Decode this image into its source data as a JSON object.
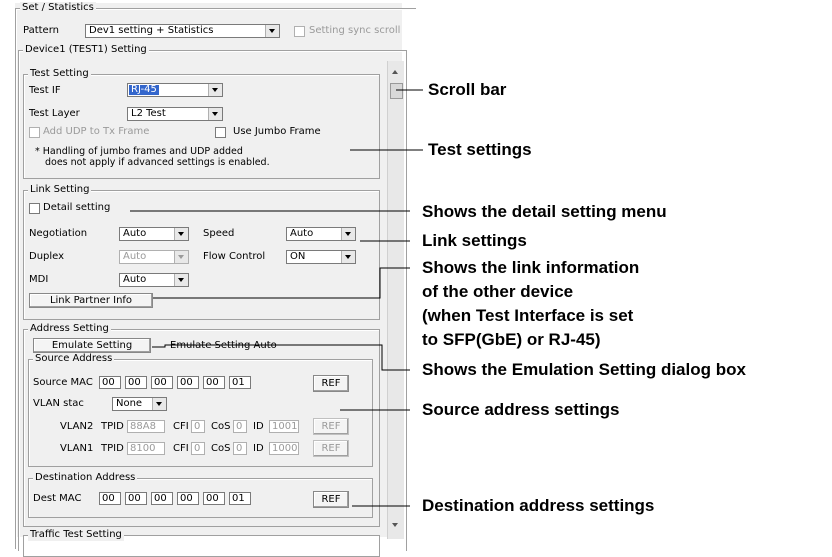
{
  "set_statistics": {
    "title": "Set / Statistics",
    "pattern_label": "Pattern",
    "pattern_value": "Dev1 setting + Statistics",
    "sync_scroll_label": "Setting sync scroll"
  },
  "device": {
    "title": "Device1 (TEST1) Setting"
  },
  "test_setting": {
    "title": "Test Setting",
    "test_if_label": "Test IF",
    "test_if_value": "RJ-45",
    "test_layer_label": "Test Layer",
    "test_layer_value": "L2 Test",
    "add_udp_label": "Add UDP to Tx Frame",
    "jumbo_label": "Use Jumbo Frame",
    "note_line1": "* Handling of jumbo frames and UDP added",
    "note_line2": "does not apply if advanced settings is enabled."
  },
  "link_setting": {
    "title": "Link Setting",
    "detail_label": "Detail setting",
    "negotiation_label": "Negotiation",
    "negotiation_value": "Auto",
    "speed_label": "Speed",
    "speed_value": "Auto",
    "duplex_label": "Duplex",
    "duplex_value": "Auto",
    "flow_label": "Flow Control",
    "flow_value": "ON",
    "mdi_label": "MDI",
    "mdi_value": "Auto",
    "partner_button": "Link Partner Info"
  },
  "address_setting": {
    "title": "Address Setting",
    "emulate_button": "Emulate Setting",
    "emulate_status": "Emulate Setting Auto",
    "source": {
      "title": "Source Address",
      "mac_label": "Source MAC",
      "mac": [
        "00",
        "00",
        "00",
        "00",
        "00",
        "01"
      ],
      "ref": "REF",
      "vlan_stack_label": "VLAN stac",
      "vlan_stack_value": "None",
      "vlan2": {
        "name": "VLAN2",
        "tpid_label": "TPID",
        "tpid": "88A8",
        "cfi_label": "CFI",
        "cfi": "0",
        "cos_label": "CoS",
        "cos": "0",
        "id_label": "ID",
        "id": "1001",
        "ref": "REF"
      },
      "vlan1": {
        "name": "VLAN1",
        "tpid_label": "TPID",
        "tpid": "8100",
        "cfi_label": "CFI",
        "cfi": "0",
        "cos_label": "CoS",
        "cos": "0",
        "id_label": "ID",
        "id": "1000",
        "ref": "REF"
      }
    },
    "destination": {
      "title": "Destination Address",
      "mac_label": "Dest MAC",
      "mac": [
        "00",
        "00",
        "00",
        "00",
        "00",
        "01"
      ],
      "ref": "REF"
    }
  },
  "traffic": {
    "title": "Traffic Test Setting"
  },
  "callouts": {
    "scroll_bar": "Scroll bar",
    "test_settings": "Test settings",
    "detail_menu": "Shows the detail setting menu",
    "link_settings": "Link settings",
    "link_info_1": "Shows the link information",
    "link_info_2": "of the other device",
    "link_info_3": "(when Test Interface is set",
    "link_info_4": "to SFP(GbE) or RJ-45)",
    "emulation_dialog": "Shows the Emulation Setting dialog box",
    "source_address": "Source address settings",
    "destination_address": "Destination address settings"
  }
}
